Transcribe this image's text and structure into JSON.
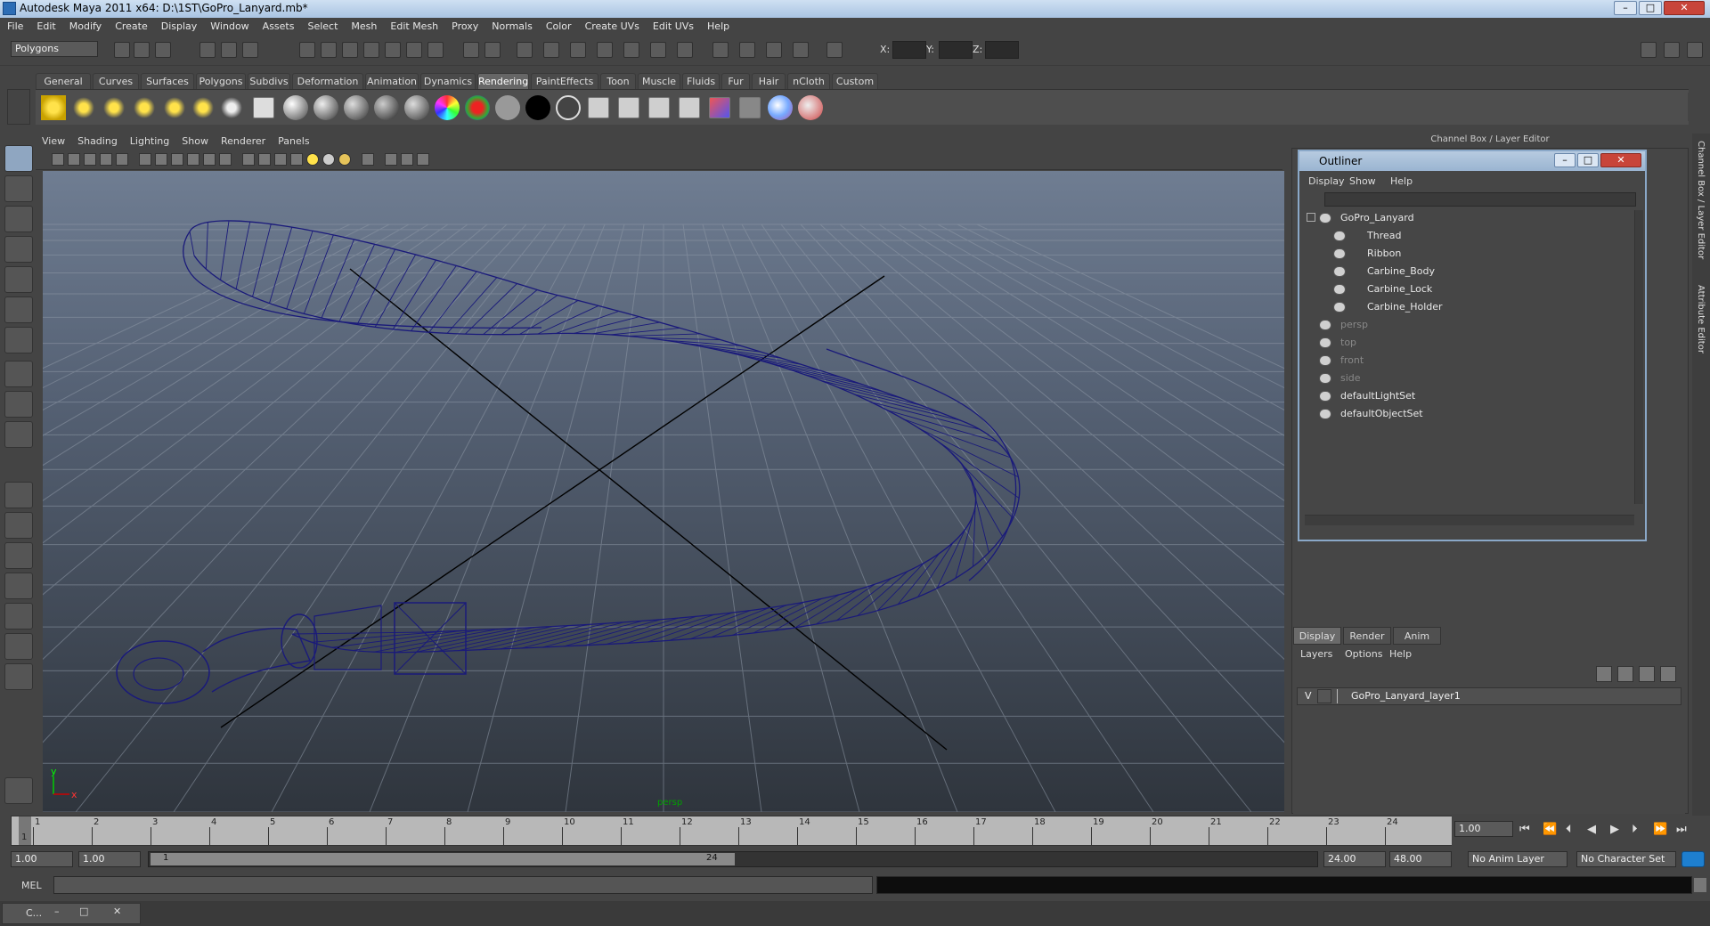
{
  "app": {
    "title": "Autodesk Maya 2011 x64: D:\\1ST\\GoPro_Lanyard.mb*"
  },
  "window_buttons": {
    "minimize": "–",
    "maximize": "□",
    "close": "✕"
  },
  "menu": [
    "File",
    "Edit",
    "Modify",
    "Create",
    "Display",
    "Window",
    "Assets",
    "Select",
    "Mesh",
    "Edit Mesh",
    "Proxy",
    "Normals",
    "Color",
    "Create UVs",
    "Edit UVs",
    "Help"
  ],
  "status": {
    "mode": "Polygons",
    "x_label": "X:",
    "y_label": "Y:",
    "z_label": "Z:"
  },
  "shelf_tabs": [
    "General",
    "Curves",
    "Surfaces",
    "Polygons",
    "Subdivs",
    "Deformation",
    "Animation",
    "Dynamics",
    "Rendering",
    "PaintEffects",
    "Toon",
    "Muscle",
    "Fluids",
    "Fur",
    "Hair",
    "nCloth",
    "Custom"
  ],
  "shelf_active": "Rendering",
  "viewport": {
    "menu": [
      "View",
      "Shading",
      "Lighting",
      "Show",
      "Renderer",
      "Panels"
    ],
    "camera_label": "persp",
    "axis_x": "x",
    "axis_y": "y",
    "wire_color": "#1a1a7a"
  },
  "channel_box_header": "Channel Box / Layer Editor",
  "side_tabs": [
    "Channel Box / Layer Editor",
    "Attribute Editor"
  ],
  "outliner": {
    "title": "Outliner",
    "menu": [
      "Display",
      "Show",
      "Help"
    ],
    "items": [
      {
        "label": "GoPro_Lanyard",
        "indent": 0,
        "dim": false
      },
      {
        "label": "Thread",
        "indent": 1,
        "dim": false
      },
      {
        "label": "Ribbon",
        "indent": 1,
        "dim": false
      },
      {
        "label": "Carbine_Body",
        "indent": 1,
        "dim": false
      },
      {
        "label": "Carbine_Lock",
        "indent": 1,
        "dim": false
      },
      {
        "label": "Carbine_Holder",
        "indent": 1,
        "dim": false
      },
      {
        "label": "persp",
        "indent": 0,
        "dim": true
      },
      {
        "label": "top",
        "indent": 0,
        "dim": true
      },
      {
        "label": "front",
        "indent": 0,
        "dim": true
      },
      {
        "label": "side",
        "indent": 0,
        "dim": true
      },
      {
        "label": "defaultLightSet",
        "indent": 0,
        "dim": false
      },
      {
        "label": "defaultObjectSet",
        "indent": 0,
        "dim": false
      }
    ]
  },
  "layer_editor": {
    "tabs": [
      "Display",
      "Render",
      "Anim"
    ],
    "menu": [
      "Layers",
      "Options",
      "Help"
    ],
    "layer": {
      "visible": "V",
      "name": "GoPro_Lanyard_layer1"
    }
  },
  "timeline": {
    "ticks": [
      "1",
      "2",
      "3",
      "4",
      "5",
      "6",
      "7",
      "8",
      "9",
      "10",
      "11",
      "12",
      "13",
      "14",
      "15",
      "16",
      "17",
      "18",
      "19",
      "20",
      "21",
      "22",
      "23",
      "24"
    ],
    "current_frame": "1.00",
    "current_marker": "1"
  },
  "range": {
    "start": "1.00",
    "start2": "1.00",
    "slider_start": "1",
    "slider_end": "24",
    "end": "24.00",
    "end2": "48.00",
    "anim_layer": "No Anim Layer",
    "char_set": "No Character Set"
  },
  "command": {
    "label": "MEL"
  },
  "taskbar": {
    "item": "C..."
  }
}
